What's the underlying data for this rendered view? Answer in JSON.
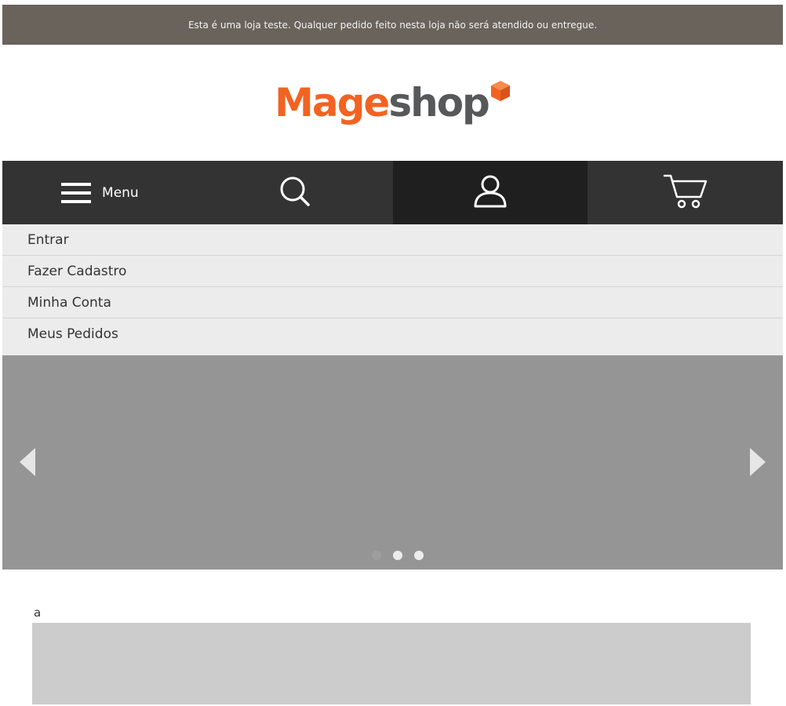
{
  "notice": {
    "text": "Esta é uma loja teste. Qualquer pedido feito nesta loja não será atendido ou entregue."
  },
  "logo": {
    "part1": "Mage",
    "part2": "shop",
    "cube_icon": "cube-icon"
  },
  "navbar": {
    "menu_label": "Menu",
    "icons": [
      "hamburger-icon",
      "search-icon",
      "user-icon",
      "cart-icon"
    ]
  },
  "account_menu": {
    "items": [
      {
        "label": "Entrar"
      },
      {
        "label": "Fazer Cadastro"
      },
      {
        "label": "Minha Conta"
      },
      {
        "label": "Meus Pedidos"
      }
    ]
  },
  "slider": {
    "prev_icon": "chevron-left-icon",
    "next_icon": "chevron-right-icon",
    "dot_count": 3,
    "active_dot": 1
  },
  "content": {
    "label": "a"
  },
  "colors": {
    "brand_orange": "#f26322",
    "brand_gray": "#57585a",
    "notice_bg": "#6a635b",
    "navbar_bg": "#333333",
    "navbar_active_bg": "#1f1f1f",
    "slider_bg": "#959595"
  }
}
